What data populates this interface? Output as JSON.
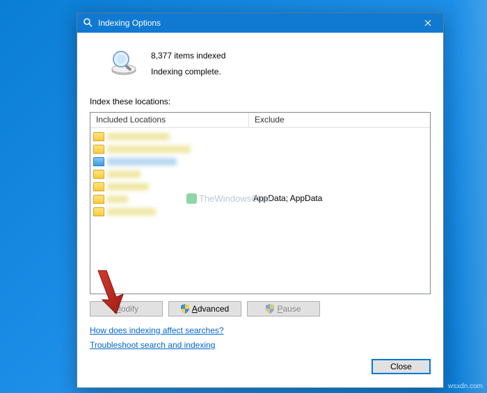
{
  "window": {
    "title": "Indexing Options"
  },
  "status": {
    "count_text": "8,377 items indexed",
    "state_text": "Indexing complete."
  },
  "section_label": "Index these locations:",
  "columns": {
    "included": "Included Locations",
    "exclude": "Exclude"
  },
  "exclude_values": {
    "row5": "AppData; AppData"
  },
  "watermark": "TheWindowsClub",
  "buttons": {
    "modify": "Modify",
    "advanced": "Advanced",
    "pause": "Pause",
    "close": "Close"
  },
  "links": {
    "help": "How does indexing affect searches?",
    "troubleshoot": "Troubleshoot search and indexing"
  },
  "footer": "wsxdn.com"
}
